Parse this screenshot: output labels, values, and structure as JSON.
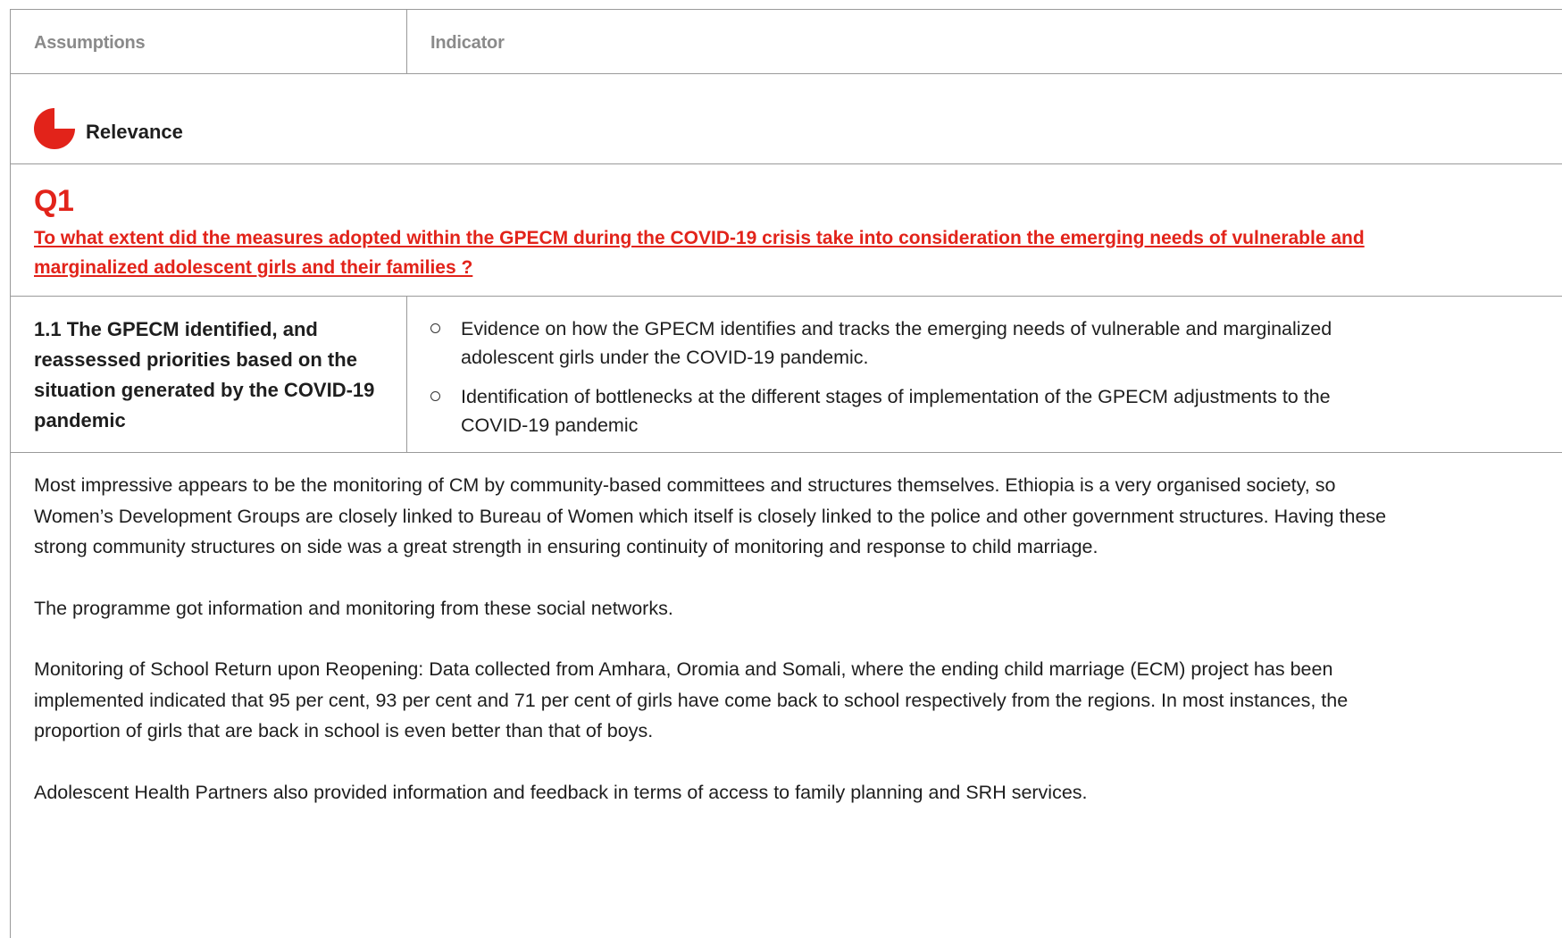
{
  "header": {
    "col1": "Assumptions",
    "col2": "Indicator"
  },
  "relevance": {
    "icon": "pie-quarter-icon",
    "label": "Relevance",
    "accent": "#e2231a"
  },
  "question": {
    "number": "Q1",
    "text": "To what extent did the measures adopted within the GPECM during the COVID-19 crisis take into consideration the emerging needs of vulnerable and marginalized adolescent girls and their families ?"
  },
  "criterion": {
    "title": "1.1 The GPECM identified, and reassessed priorities based on the situation generated by the COVID-19 pandemic",
    "indicators": [
      "Evidence on how the GPECM identifies and tracks the emerging needs of vulnerable and marginalized adolescent girls under the COVID-19 pandemic.",
      "Identification of bottlenecks at the different  stages of implementation  of the GPECM adjustments to the COVID-19 pandemic"
    ]
  },
  "body": {
    "paragraphs": [
      "Most impressive appears to be the monitoring of CM by community-based committees and structures themselves. Ethiopia is a very organised society, so Women’s Development Groups are closely linked to Bureau of Women which itself is closely linked to the police and other government structures. Having these strong community structures on side was a great strength in ensuring continuity of monitoring and response to child marriage.",
      "The programme got information and monitoring from these social networks.",
      "Monitoring of School Return upon Reopening: Data collected from Amhara, Oromia and Somali, where the ending child marriage (ECM) project has been implemented indicated that 95 per cent, 93 per cent and 71 per cent of girls have come back to school respectively from the regions. In most instances, the proportion of girls that are back in school is even better than that of boys.",
      "Adolescent Health Partners also provided information and feedback in terms of access to family planning and SRH services."
    ]
  }
}
